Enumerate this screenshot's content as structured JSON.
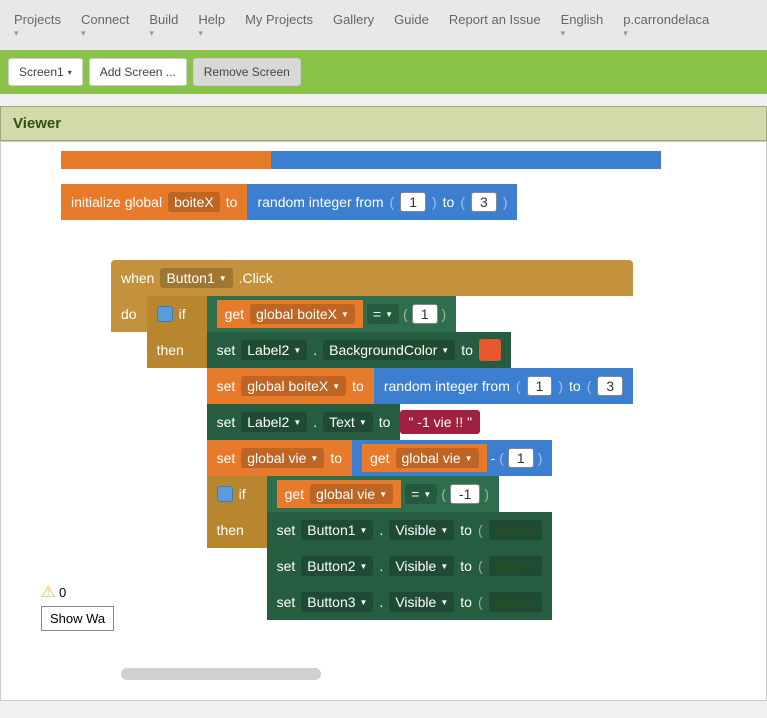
{
  "menu": [
    "Projects",
    "Connect",
    "Build",
    "Help",
    "My Projects",
    "Gallery",
    "Guide",
    "Report an Issue",
    "English",
    "p.carrondelaca"
  ],
  "menu_has_caret": [
    true,
    true,
    true,
    true,
    false,
    false,
    false,
    false,
    true,
    true
  ],
  "toolbar": {
    "screen": "Screen1",
    "add": "Add Screen ...",
    "remove": "Remove Screen"
  },
  "panel": "Viewer",
  "b1": {
    "init": "initialize global",
    "var": "boiteX",
    "to": "to",
    "rand": "random integer from",
    "n1": "1",
    "to2": "to",
    "n2": "3"
  },
  "b2": {
    "when": "when",
    "comp": "Button1",
    "evt": ".Click",
    "do": "do",
    "if": "if",
    "then": "then",
    "get": "get",
    "gboitex": "global boiteX",
    "eq": "=",
    "one": "1",
    "set": "set",
    "label2": "Label2",
    "bgcolor": "BackgroundColor",
    "to": "to",
    "rand": "random integer from",
    "n1": "1",
    "n3": "3",
    "text": "Text",
    "vietext": "\" -1 vie !! \"",
    "gvie": "global vie",
    "minus": "-",
    "neg1": "-1",
    "btn1": "Button1",
    "btn2": "Button2",
    "btn3": "Button3",
    "visible": "Visible",
    "false": "false"
  },
  "warn": {
    "count": "0",
    "show": "Show Wa"
  }
}
